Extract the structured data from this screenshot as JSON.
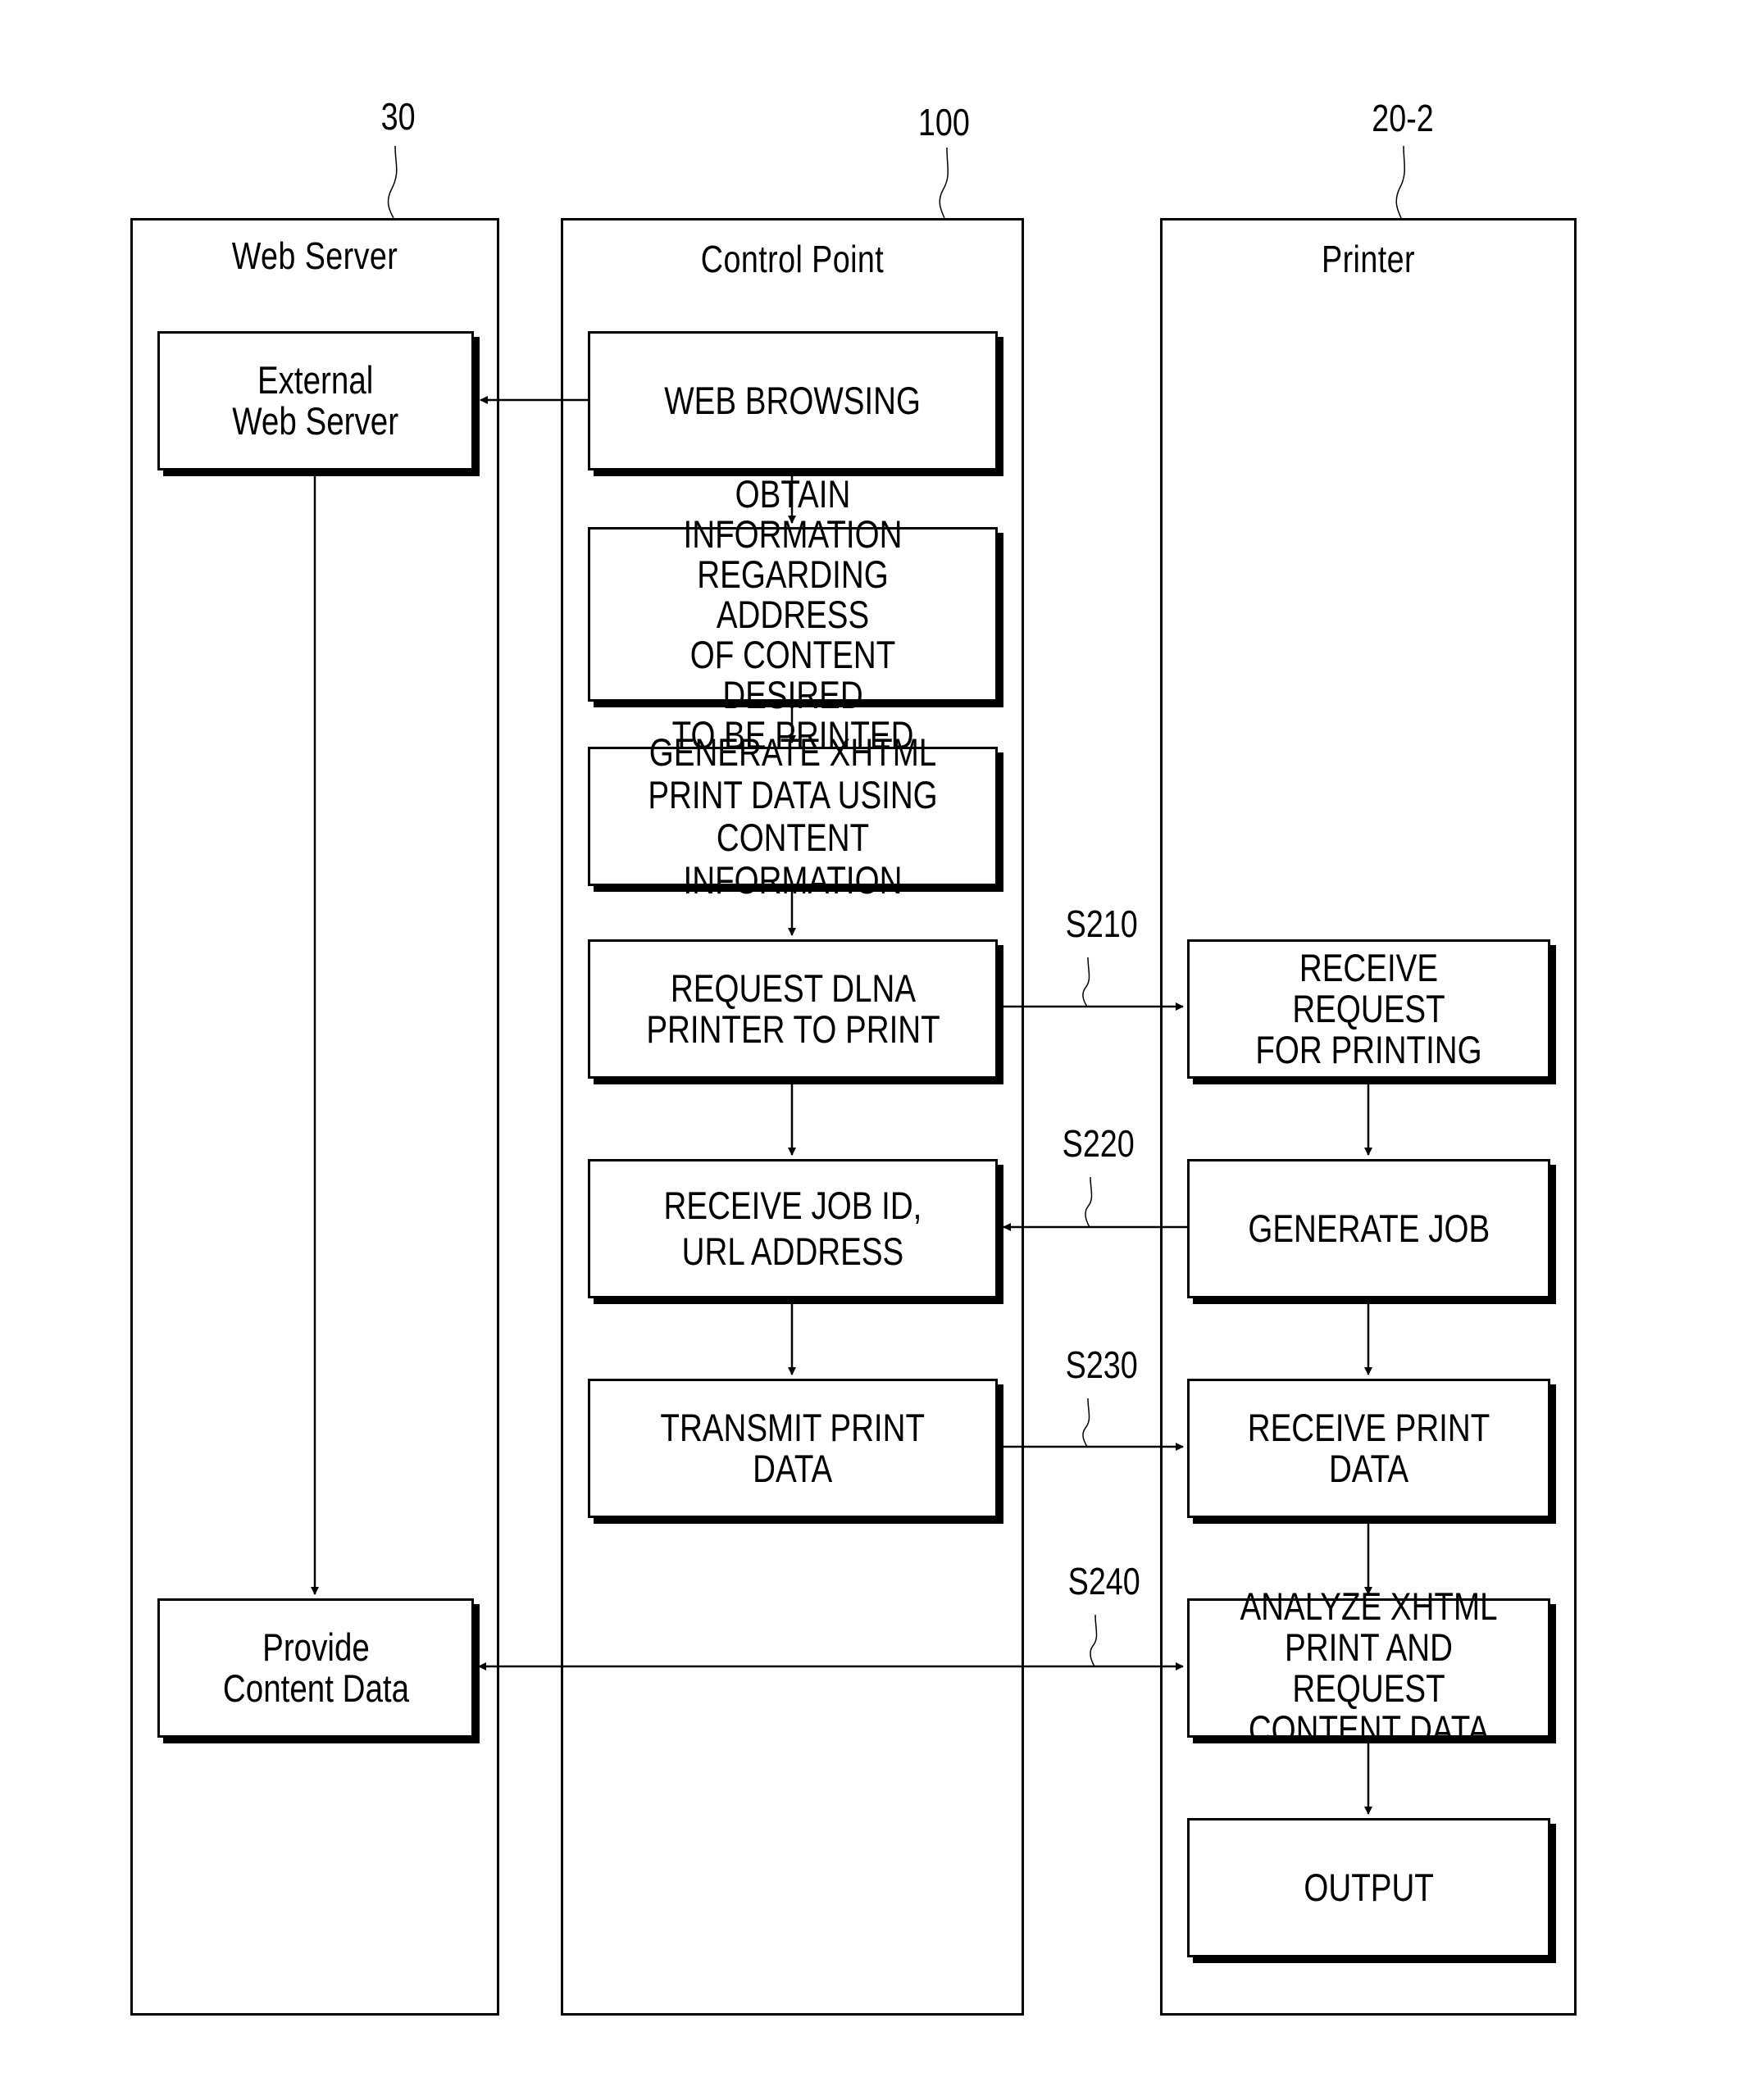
{
  "lanes": [
    {
      "id": "web-server",
      "title": "Web Server",
      "ref": "30"
    },
    {
      "id": "control-point",
      "title": "Control Point",
      "ref": "100"
    },
    {
      "id": "printer",
      "title": "Printer",
      "ref": "20-2"
    }
  ],
  "web_server": {
    "external_web_server": "External\nWeb Server",
    "provide_content_data": "Provide\nContent Data"
  },
  "control_point": {
    "web_browsing": "WEB BROWSING",
    "obtain_information": "OBTAIN INFORMATION\nREGARDING ADDRESS\nOF CONTENT DESIRED\nTO BE PRINTED",
    "generate_xhtml": "GENERATE XHTML\nPRINT DATA USING\nCONTENT INFORMATION",
    "request_dlna": "REQUEST DLNA\nPRINTER TO PRINT",
    "receive_job_id": "RECEIVE JOB ID,\nURL ADDRESS",
    "transmit_print_data": "TRANSMIT PRINT\nDATA"
  },
  "printer": {
    "receive_request": "RECEIVE REQUEST\nFOR PRINTING",
    "generate_job": "GENERATE JOB",
    "receive_print_data": "RECEIVE PRINT DATA",
    "analyze_xhtml": "ANALYZE XHTML\nPRINT AND REQUEST\nCONTENT DATA",
    "output": "OUTPUT"
  },
  "steps": {
    "s210": "S210",
    "s220": "S220",
    "s230": "S230",
    "s240": "S240"
  }
}
